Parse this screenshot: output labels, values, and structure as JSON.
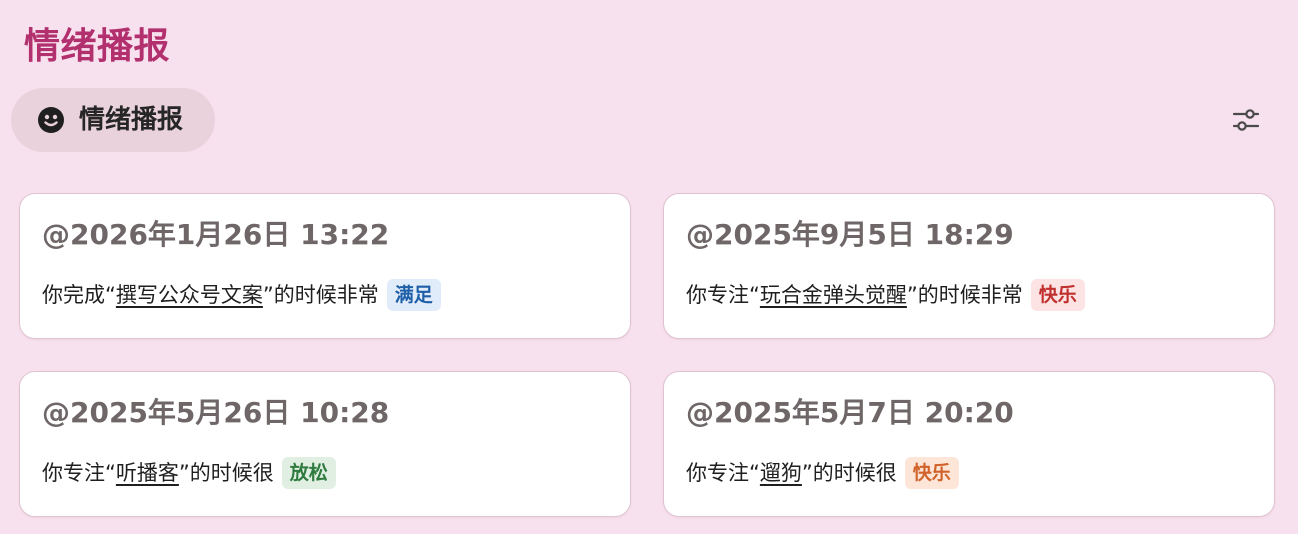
{
  "page_title": "情绪播报",
  "filter_chip": {
    "label": "情绪播报",
    "icon": "smiley-face-icon"
  },
  "settings": {
    "icon": "sliders-icon"
  },
  "cards": [
    {
      "time": "@2026年1月26日 13:22",
      "prefix": "你完成“",
      "activity": "撰写公众号文案",
      "suffix": "”的时候非常",
      "mood": "满足",
      "mood_color": "#1f5fa8",
      "mood_bg": "#e1ecfa"
    },
    {
      "time": "@2025年9月5日 18:29",
      "prefix": "你专注“",
      "activity": "玩合金弹头觉醒",
      "suffix": "”的时候非常",
      "mood": "快乐",
      "mood_color": "#c0302f",
      "mood_bg": "#fde3e3"
    },
    {
      "time": "@2025年5月26日 10:28",
      "prefix": "你专注“",
      "activity": "听播客",
      "suffix": "”的时候很",
      "mood": "放松",
      "mood_color": "#2f7a3f",
      "mood_bg": "#e0efe2"
    },
    {
      "time": "@2025年5月7日 20:20",
      "prefix": "你专注“",
      "activity": "遛狗",
      "suffix": "”的时候很",
      "mood": "快乐",
      "mood_color": "#d0622a",
      "mood_bg": "#fde6d8"
    }
  ]
}
